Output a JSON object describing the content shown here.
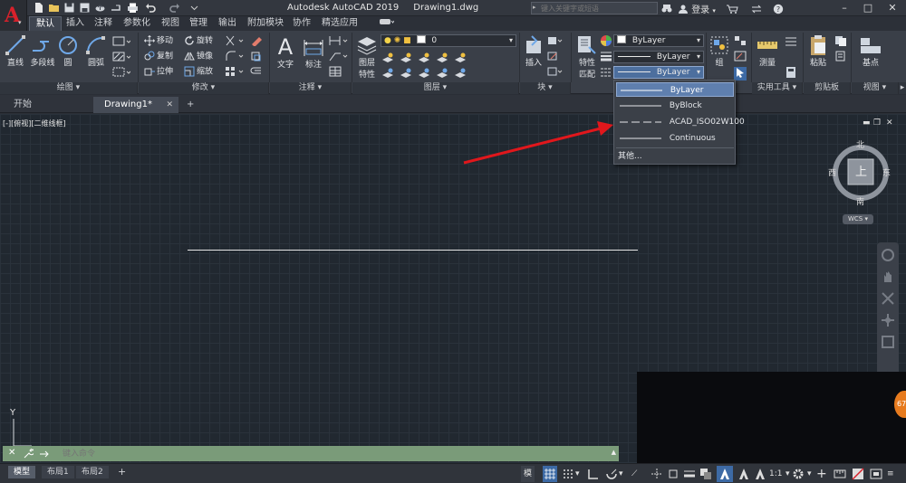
{
  "window": {
    "app_title": "Autodesk AutoCAD 2019",
    "file_title": "Drawing1.dwg",
    "search_placeholder": "键入关键字或短语",
    "login_label": "登录",
    "app_button_letter": "A"
  },
  "ribbon_tabs": [
    {
      "label": "默认",
      "active": true
    },
    {
      "label": "插入"
    },
    {
      "label": "注释"
    },
    {
      "label": "参数化"
    },
    {
      "label": "视图"
    },
    {
      "label": "管理"
    },
    {
      "label": "输出"
    },
    {
      "label": "附加模块"
    },
    {
      "label": "协作"
    },
    {
      "label": "精选应用"
    }
  ],
  "ribbon": {
    "draw": {
      "title": "绘图",
      "line": "直线",
      "polyline": "多段线",
      "circle": "圆",
      "arc": "圆弧"
    },
    "modify": {
      "title": "修改",
      "move": "移动",
      "rotate": "旋转",
      "copy": "复制",
      "mirror": "镜像",
      "stretch": "拉伸",
      "scale": "缩放"
    },
    "annotation": {
      "title": "注释",
      "text": "文字",
      "dimension": "标注"
    },
    "layers": {
      "title": "图层",
      "layer_properties_line1": "图层",
      "layer_properties_line2": "特性",
      "current_layer": "0"
    },
    "block": {
      "title": "块",
      "insert": "插入"
    },
    "properties": {
      "match_line1": "特性",
      "match_line2": "匹配",
      "color": "ByLayer",
      "lineweight": "ByLayer",
      "linetype": "ByLayer"
    },
    "groups": {
      "group": "组"
    },
    "utilities": {
      "title": "实用工具",
      "measure": "测量"
    },
    "clipboard": {
      "title": "剪贴板",
      "paste": "粘贴"
    },
    "view": {
      "title": "视图",
      "base": "基点"
    }
  },
  "file_tabs": [
    {
      "label": "开始"
    },
    {
      "label": "Drawing1*",
      "active": true
    }
  ],
  "viewport": {
    "label": "[-][俯视][二维线框]",
    "viewcube": {
      "north": "北",
      "south": "南",
      "east": "东",
      "west": "西",
      "face": "上"
    },
    "wcs": "WCS",
    "ucs_y": "Y",
    "badge": "67"
  },
  "linetype_dropdown": {
    "items": [
      {
        "label": "ByLayer",
        "selected": true,
        "style": "solid"
      },
      {
        "label": "ByBlock",
        "style": "solid"
      },
      {
        "label": "ACAD_ISO02W100",
        "style": "dashed"
      },
      {
        "label": "Continuous",
        "style": "solid"
      },
      {
        "label": "其他..."
      }
    ]
  },
  "command_line": {
    "placeholder": "键入命令"
  },
  "layout_tabs": [
    {
      "label": "模型",
      "active": true
    },
    {
      "label": "布局1"
    },
    {
      "label": "布局2"
    }
  ],
  "status_bar": {
    "model": "模型",
    "scale": "1:1"
  },
  "colors": {
    "accent": "#5f7fae",
    "arrow": "#e0171c",
    "canvas": "#212830",
    "app_red": "#d8212b"
  }
}
